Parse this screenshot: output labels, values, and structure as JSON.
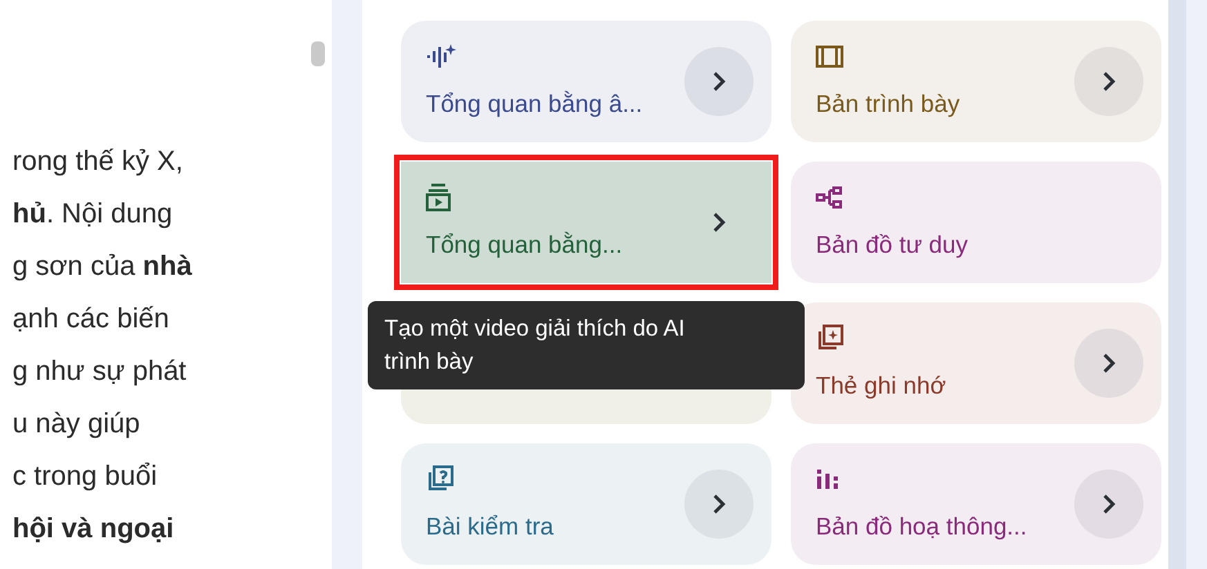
{
  "document": {
    "lines": [
      "rong thế kỷ X,",
      "**hủ**. Nội dung",
      "g sơn của **nhà**",
      "ạnh các biến",
      "g như sự phát",
      "u này giúp",
      "c trong buổi",
      "**hội và ngoại**"
    ]
  },
  "studio": {
    "cards": [
      {
        "label": "Tổng quan bằng â...",
        "kind": "audio",
        "color": "#3b4a8c",
        "show_arrow": true,
        "highlighted": false
      },
      {
        "label": "Bản trình bày",
        "kind": "slides",
        "color": "#7a5a1c",
        "show_arrow": true,
        "highlighted": false
      },
      {
        "label": "Tổng quan bằng...",
        "kind": "video",
        "color": "#24613a",
        "show_arrow": true,
        "highlighted": true
      },
      {
        "label": "Bản đồ tư duy",
        "kind": "mindmap",
        "color": "#8a2a7a",
        "show_arrow": false,
        "highlighted": false
      },
      {
        "kind": "report"
      },
      {
        "label": "Thẻ ghi nhớ",
        "kind": "flashcards",
        "color": "#8a3a2a",
        "show_arrow": true,
        "highlighted": false
      },
      {
        "label": "Bài kiểm tra",
        "kind": "quiz",
        "color": "#2a6a8a",
        "show_arrow": true,
        "highlighted": false
      },
      {
        "label": "Bản đồ hoạ thông...",
        "kind": "infographic",
        "color": "#8a2a7a",
        "show_arrow": true,
        "highlighted": false
      }
    ],
    "tooltip": "Tạo một video giải thích do AI trình bày"
  }
}
